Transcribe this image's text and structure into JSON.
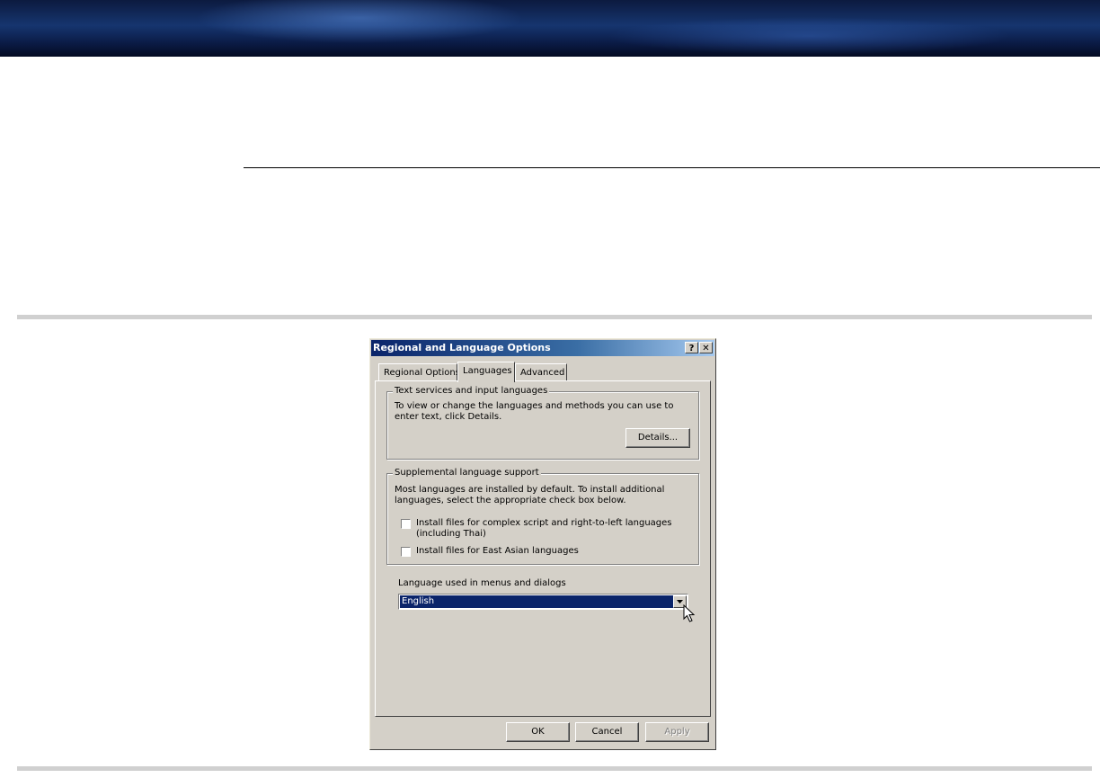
{
  "dialog": {
    "title": "Regional and Language Options",
    "help_glyph": "?",
    "close_glyph": "✕",
    "tabs": [
      "Regional Options",
      "Languages",
      "Advanced"
    ],
    "active_tab": "Languages",
    "text_services": {
      "legend": "Text services and input languages",
      "description": "To view or change the languages and methods you can use to enter text, click Details.",
      "details_button": "Details..."
    },
    "supplemental": {
      "legend": "Supplemental language support",
      "description": "Most languages are installed by default. To install additional languages, select the appropriate check box below.",
      "checkboxes": [
        {
          "label": "Install files for complex script and right-to-left languages (including Thai)",
          "checked": false
        },
        {
          "label": "Install files for East Asian languages",
          "checked": false
        }
      ]
    },
    "menu_language": {
      "label": "Language used in menus and dialogs",
      "selected": "English"
    },
    "buttons": {
      "ok": "OK",
      "cancel": "Cancel",
      "apply": "Apply"
    }
  },
  "colors": {
    "titlebar_start": "#0a246a",
    "dialog_face": "#d4d0c8",
    "selection": "#0a246a"
  },
  "icons": [
    "help-icon",
    "close-icon",
    "dropdown-arrow-icon",
    "mouse-pointer-icon"
  ]
}
